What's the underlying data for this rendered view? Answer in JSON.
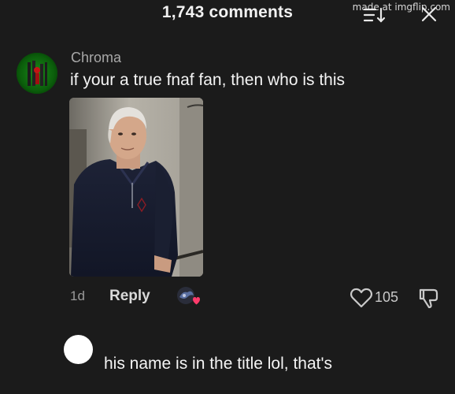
{
  "header": {
    "title": "1,743 comments",
    "sort_icon": "sort-icon",
    "close_icon": "close-icon"
  },
  "watermark": "made at imgflip.com",
  "comment": {
    "username": "Chroma",
    "text": "if your a true fnaf fan, then who is this",
    "timestamp": "1d",
    "reply_label": "Reply",
    "like_count": "105",
    "like_icon": "heart-icon",
    "dislike_icon": "dislike-icon"
  },
  "reply": {
    "text": "his name is in the title lol, that's"
  },
  "colors": {
    "background": "#1b1b1b",
    "text_primary": "#f4f4f4",
    "text_secondary": "#a8a8a8",
    "reaction_heart": "#ff3b6b"
  }
}
